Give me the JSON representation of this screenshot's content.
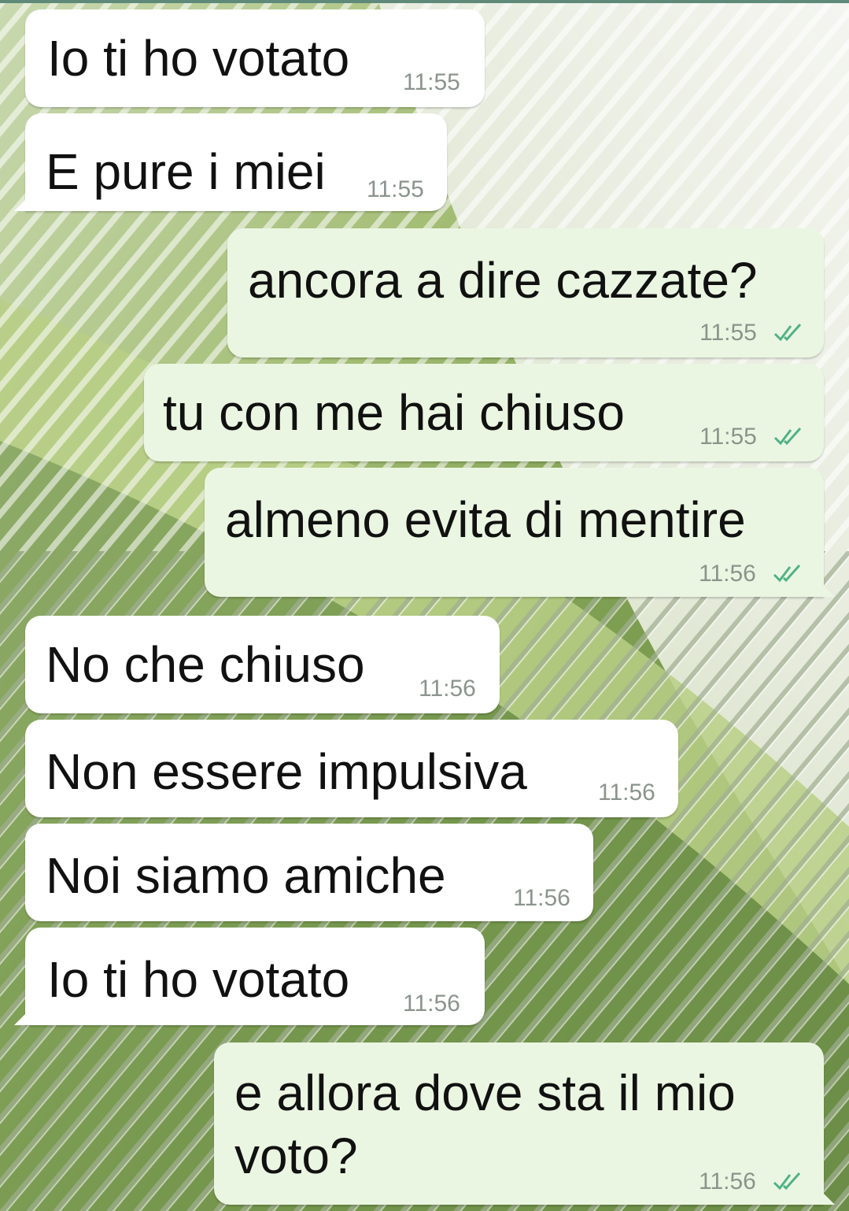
{
  "chat": {
    "messages": [
      {
        "direction": "incoming",
        "text": "Io ti ho votato",
        "time": "11:55"
      },
      {
        "direction": "incoming",
        "text": "E pure i miei",
        "time": "11:55"
      },
      {
        "direction": "outgoing",
        "text": "ancora a dire cazzate?",
        "time": "11:55",
        "status": "read"
      },
      {
        "direction": "outgoing",
        "text": "tu con me hai chiuso",
        "time": "11:55",
        "status": "read"
      },
      {
        "direction": "outgoing",
        "text": "almeno evita di mentire",
        "time": "11:56",
        "status": "read"
      },
      {
        "direction": "incoming",
        "text": "No che chiuso",
        "time": "11:56"
      },
      {
        "direction": "incoming",
        "text": "Non essere impulsiva",
        "time": "11:56"
      },
      {
        "direction": "incoming",
        "text": "Noi siamo amiche",
        "time": "11:56"
      },
      {
        "direction": "incoming",
        "text": "Io ti ho votato",
        "time": "11:56"
      },
      {
        "direction": "outgoing",
        "text": "e allora dove sta il mio",
        "text_line2": "voto?",
        "time": "11:56",
        "status": "read"
      }
    ]
  },
  "colors": {
    "incoming_bubble": "#ffffff",
    "outgoing_bubble": "#ebf6e2",
    "timestamp": "#8a948c",
    "read_ticks": "#4fb287",
    "wallpaper_light": "#f2f4ee",
    "wallpaper_green": "#a6c26e",
    "wallpaper_dark": "#5e7d3c"
  },
  "icons": {
    "read_receipt": "double-check-icon",
    "wallpaper": "green-striped-wallpaper"
  }
}
